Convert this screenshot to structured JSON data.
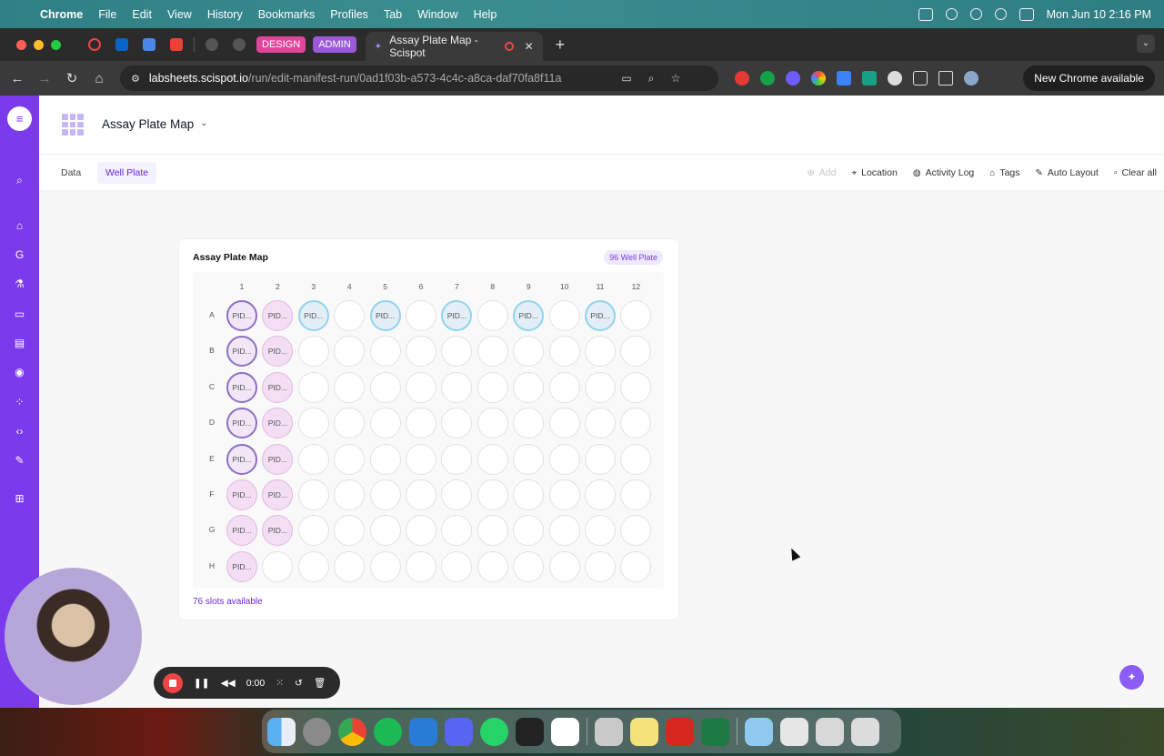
{
  "menubar": {
    "app": "Chrome",
    "items": [
      "File",
      "Edit",
      "View",
      "History",
      "Bookmarks",
      "Profiles",
      "Tab",
      "Window",
      "Help"
    ],
    "clock": "Mon Jun 10  2:16 PM"
  },
  "tabs": {
    "pill_design": "DESIGN",
    "pill_admin": "ADMIN",
    "active_title": "Assay Plate Map - Scispot",
    "design_color": "#e0459b",
    "admin_color": "#9b59d9"
  },
  "address": {
    "domain": "labsheets.scispot.io",
    "path": "/run/edit-manifest-run/0ad1f03b-a573-4c4c-a8ca-daf70fa8f11a",
    "new_chrome": "New Chrome available"
  },
  "app": {
    "accent": "#7c3aed",
    "title": "Assay Plate Map",
    "subtabs": [
      "Data",
      "Well Plate"
    ],
    "active_subtab": "Well Plate",
    "tools": {
      "add": "Add",
      "location": "Location",
      "activity_log": "Activity Log",
      "tags": "Tags",
      "auto_layout": "Auto Layout",
      "clear_all": "Clear all"
    }
  },
  "plate": {
    "title": "Assay Plate Map",
    "badge": "96 Well Plate",
    "columns": [
      "1",
      "2",
      "3",
      "4",
      "5",
      "6",
      "7",
      "8",
      "9",
      "10",
      "11",
      "12"
    ],
    "rows": [
      "A",
      "B",
      "C",
      "D",
      "E",
      "F",
      "G",
      "H"
    ],
    "well_label": "PID...",
    "filled": {
      "A": [
        "pa",
        "pb",
        "pc",
        "",
        "pc",
        "",
        "pc",
        "",
        "pc",
        "",
        "pc",
        ""
      ],
      "B": [
        "pa",
        "pb",
        "",
        "",
        "",
        "",
        "",
        "",
        "",
        "",
        "",
        ""
      ],
      "C": [
        "pa",
        "pb",
        "",
        "",
        "",
        "",
        "",
        "",
        "",
        "",
        "",
        ""
      ],
      "D": [
        "pa",
        "pb",
        "",
        "",
        "",
        "",
        "",
        "",
        "",
        "",
        "",
        ""
      ],
      "E": [
        "pa",
        "pb",
        "",
        "",
        "",
        "",
        "",
        "",
        "",
        "",
        "",
        ""
      ],
      "F": [
        "pb",
        "pb",
        "",
        "",
        "",
        "",
        "",
        "",
        "",
        "",
        "",
        ""
      ],
      "G": [
        "pb",
        "pb",
        "",
        "",
        "",
        "",
        "",
        "",
        "",
        "",
        "",
        ""
      ],
      "H": [
        "pb",
        "",
        "",
        "",
        "",
        "",
        "",
        "",
        "",
        "",
        "",
        ""
      ]
    },
    "slots_available": "76 slots available"
  },
  "recorder": {
    "time": "0:00"
  }
}
